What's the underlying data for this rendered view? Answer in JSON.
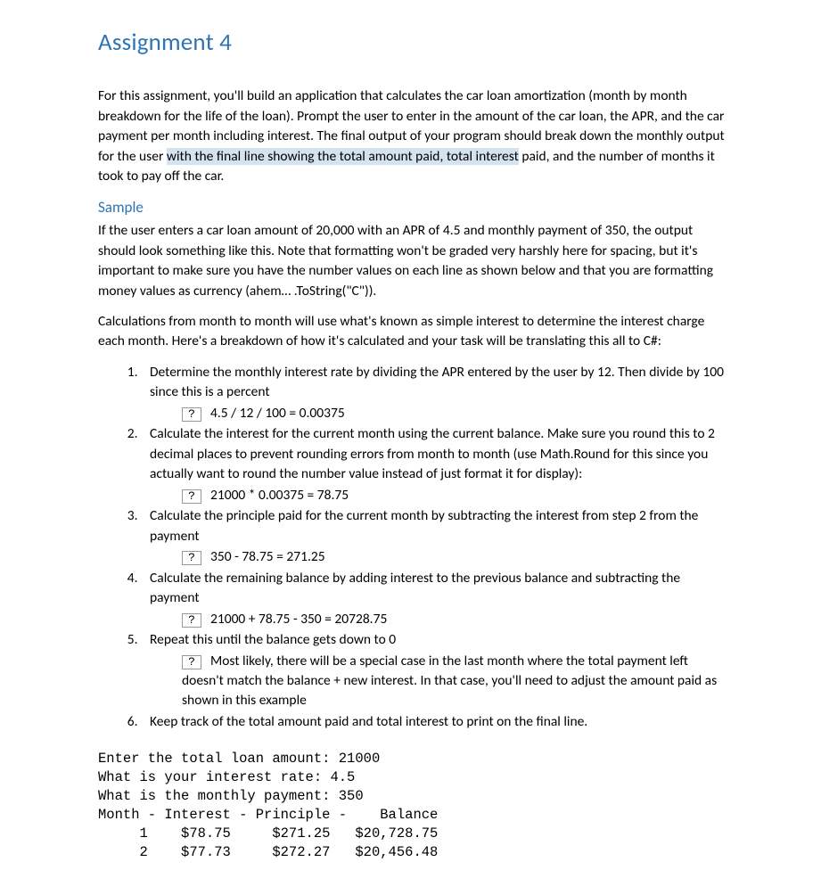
{
  "title": "Assignment 4",
  "intro": {
    "pre": "For this assignment, you'll build an application that calculates the car loan amortization (month by month breakdown for the life of the loan). Prompt the user to enter in the amount of the car loan, the APR, and the car payment per month including interest. The final output of your program should break down the monthly output for the user ",
    "highlight": "with the final line showing the total amount paid, total interest",
    "post": " paid, and the number of months it took to pay off the car."
  },
  "sample": {
    "heading": "Sample",
    "p1": "If the user enters a car loan amount of 20,000 with an APR of 4.5 and monthly payment of 350, the output should look something like this. Note that formatting won't be graded very harshly here for spacing, but it's important to make sure you have the number values on each line as shown below and that you are formatting money values as currency (ahem… .ToString(\"C\")).",
    "p2": "Calculations from month to month will use what's known as simple interest to determine the interest charge each month. Here's a breakdown of how it's calculated and your task will be translating this all to C#:"
  },
  "bullet_glyph": "?",
  "steps": [
    {
      "text": "Determine the monthly interest rate by dividing the APR entered by the user by 12. Then divide by 100 since this is a percent",
      "sub": [
        "4.5 / 12 / 100 = 0.00375"
      ]
    },
    {
      "text": "Calculate the interest for the current month using the current balance. Make sure you round this to 2 decimal places to prevent rounding errors from month to month (use Math.Round for this since you actually want to round the number value instead of just format it for display):",
      "sub": [
        "21000 * 0.00375 = 78.75"
      ]
    },
    {
      "text": "Calculate the principle paid for the current month by subtracting the interest from step 2 from the payment",
      "sub": [
        "350 - 78.75 = 271.25"
      ]
    },
    {
      "text": "Calculate the remaining balance by adding interest to the previous balance and subtracting the payment",
      "sub": [
        "21000 + 78.75 - 350 = 20728.75"
      ]
    },
    {
      "text": "Repeat this until the balance gets down to 0",
      "sub": [
        "Most likely, there will be a special case in the last month where the total payment left doesn't match the balance + new interest. In that case, you'll need to adjust the amount paid as shown in this example"
      ]
    },
    {
      "text": "Keep track of the total amount paid and total interest to print on the final line.",
      "sub": []
    }
  ],
  "console": "Enter the total loan amount: 21000\nWhat is your interest rate: 4.5\nWhat is the monthly payment: 350\nMonth - Interest - Principle -    Balance\n     1    $78.75     $271.25   $20,728.75\n     2    $77.73     $272.27   $20,456.48"
}
